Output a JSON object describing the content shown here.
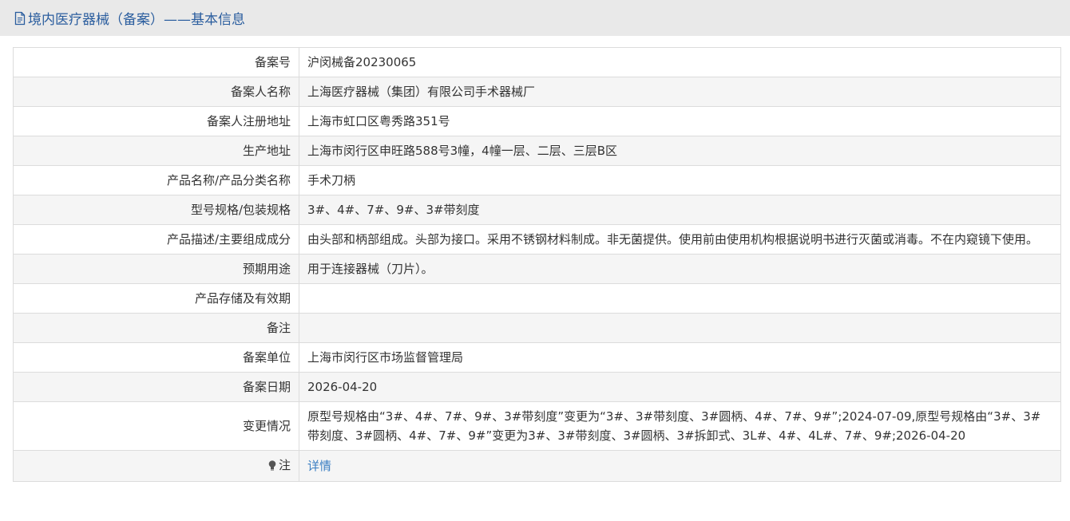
{
  "header": {
    "title": "境内医疗器械（备案）——基本信息"
  },
  "rows": [
    {
      "label": "备案号",
      "value": "沪闵械备20230065"
    },
    {
      "label": "备案人名称",
      "value": "上海医疗器械（集团）有限公司手术器械厂"
    },
    {
      "label": "备案人注册地址",
      "value": "上海市虹口区粤秀路351号"
    },
    {
      "label": "生产地址",
      "value": "上海市闵行区申旺路588号3幢，4幢一层、二层、三层B区"
    },
    {
      "label": "产品名称/产品分类名称",
      "value": "手术刀柄"
    },
    {
      "label": "型号规格/包装规格",
      "value": "3#、4#、7#、9#、3#带刻度"
    },
    {
      "label": "产品描述/主要组成成分",
      "value": "由头部和柄部组成。头部为接口。采用不锈钢材料制成。非无菌提供。使用前由使用机构根据说明书进行灭菌或消毒。不在内窥镜下使用。"
    },
    {
      "label": "预期用途",
      "value": "用于连接器械（刀片）。"
    },
    {
      "label": "产品存储及有效期",
      "value": ""
    },
    {
      "label": "备注",
      "value": ""
    },
    {
      "label": "备案单位",
      "value": "上海市闵行区市场监督管理局"
    },
    {
      "label": "备案日期",
      "value": "2026-04-20"
    },
    {
      "label": "变更情况",
      "value": "原型号规格由“3#、4#、7#、9#、3#带刻度”变更为“3#、3#带刻度、3#圆柄、4#、7#、9#”;2024-07-09,原型号规格由“3#、3#带刻度、3#圆柄、4#、7#、9#”变更为3#、3#带刻度、3#圆柄、3#拆卸式、3L#、4#、4L#、7#、9#;2026-04-20"
    }
  ],
  "note": {
    "label": "注",
    "link": "详情",
    "icon": "lightbulb-icon"
  },
  "colors": {
    "title": "#2a5d9e",
    "link": "#3a7ec2",
    "header_bg": "#e9e9e9",
    "row_alt": "#f5f5f5",
    "border": "#dcdcdc"
  }
}
